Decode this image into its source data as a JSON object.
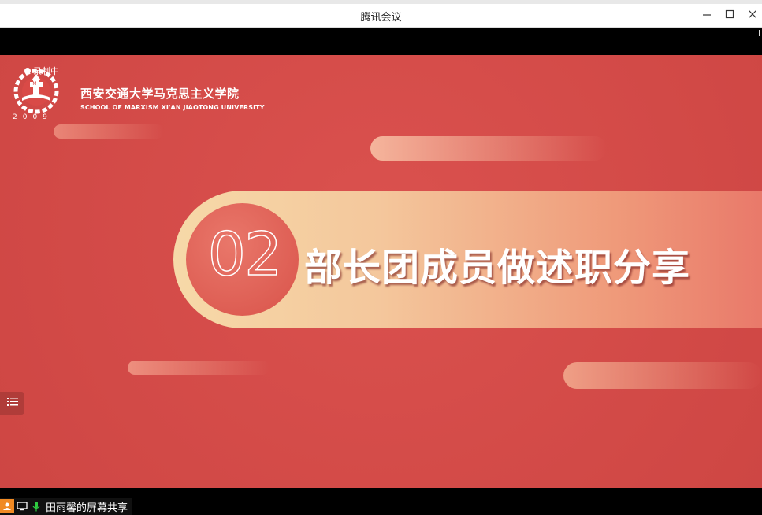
{
  "window": {
    "title": "腾讯会议",
    "minimize_icon": "minimize-icon",
    "maximize_icon": "maximize-icon",
    "close_icon": "close-icon"
  },
  "slide": {
    "recording_label": "录制中",
    "school_name_cn": "西安交通大学马克思主义学院",
    "school_name_en": "SCHOOL OF MARXISM XI'AN JIAOTONG UNIVERSITY",
    "logo_year": "2009",
    "section_number": "02",
    "section_title": "部长团成员做述职分享",
    "colors": {
      "background": "#d94a47",
      "banner_start": "#f6d9a8",
      "banner_end": "#e9796a"
    }
  },
  "sidebar": {
    "menu_icon": "list-menu-icon"
  },
  "status": {
    "share_label": "田雨馨的屏幕共享",
    "icons": [
      "participant-icon",
      "screen-share-icon",
      "microphone-icon"
    ]
  }
}
